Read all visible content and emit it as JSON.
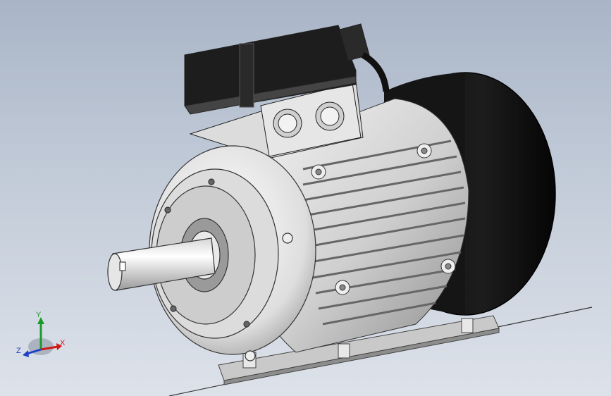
{
  "viewport": {
    "background_top": "#a9b5c7",
    "background_bottom": "#dde2ea"
  },
  "model": {
    "subject": "electric-motor",
    "icon": "motor-3d-model"
  },
  "triad": {
    "x_label": "X",
    "y_label": "Y",
    "z_label": "Z",
    "x_color": "#d01818",
    "y_color": "#1a9a2a",
    "z_color": "#2040c8"
  }
}
